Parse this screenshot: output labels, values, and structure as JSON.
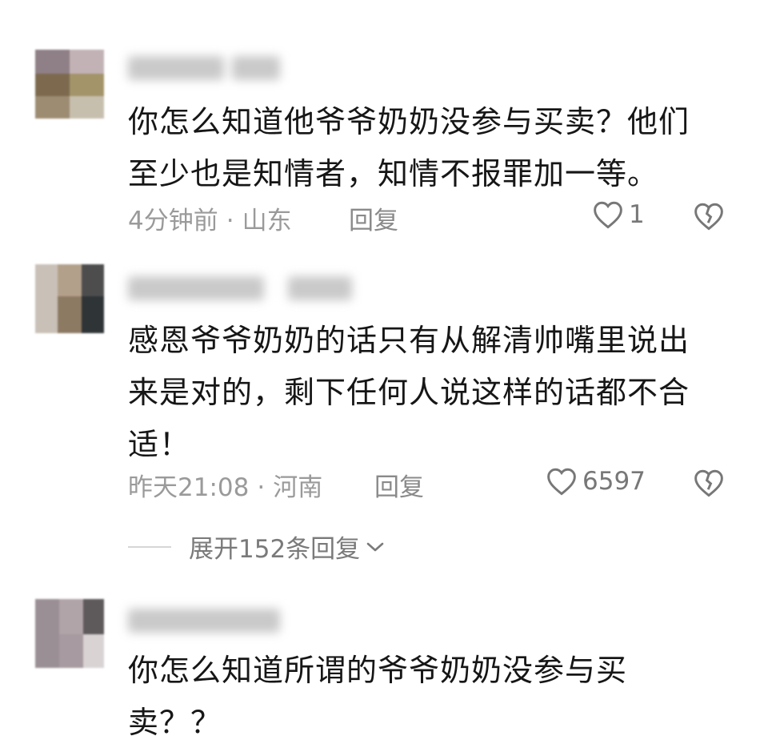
{
  "comments": [
    {
      "text_lines": [
        "你怎么知道他爷爷奶奶没参与买卖？他们",
        "至少也是知情者，知情不报罪加一等。"
      ],
      "time": "4分钟前",
      "location": "山东",
      "reply_label": "回复",
      "likes": "1"
    },
    {
      "text_lines": [
        "感恩爷爷奶奶的话只有从解清帅嘴里说出",
        "来是对的，剩下任何人说这样的话都不合",
        "适！"
      ],
      "time": "昨天21:08",
      "location": "河南",
      "reply_label": "回复",
      "likes": "6597",
      "expand_label": "展开152条回复"
    },
    {
      "text_lines": [
        "你怎么知道所谓的爷爷奶奶没参与买",
        "卖？？"
      ]
    }
  ],
  "icons": {
    "like": "heart-outline-icon",
    "dislike": "broken-heart-icon",
    "expand": "chevron-down-icon"
  },
  "colors": {
    "text": "#161616",
    "meta": "#9a9a9a",
    "icon": "#777777"
  }
}
